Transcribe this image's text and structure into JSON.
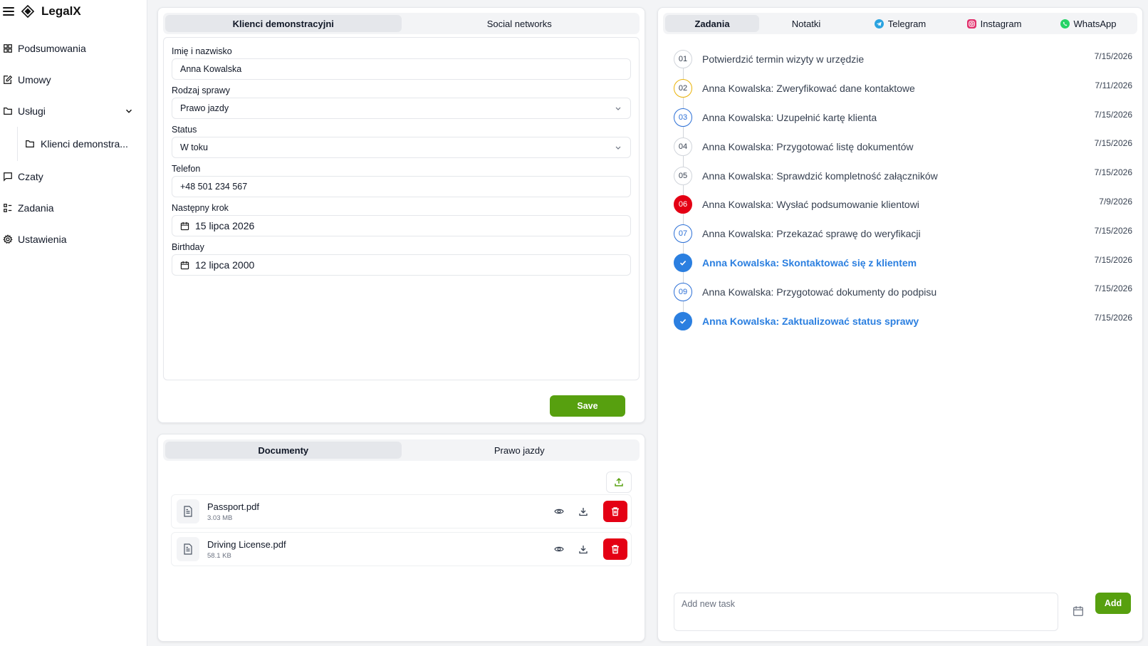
{
  "app": {
    "name": "LegalX"
  },
  "sidebar": {
    "items": [
      {
        "label": "Podsumowania",
        "icon": "dashboard-icon"
      },
      {
        "label": "Umowy",
        "icon": "edit-document-icon"
      },
      {
        "label": "Usługi",
        "icon": "folder-icon",
        "expanded": true
      },
      {
        "label": "Klienci demonstra...",
        "icon": "folder-icon",
        "sub": true
      },
      {
        "label": "Czaty",
        "icon": "chat-icon"
      },
      {
        "label": "Zadania",
        "icon": "list-icon"
      },
      {
        "label": "Ustawienia",
        "icon": "gear-icon"
      }
    ]
  },
  "client_card": {
    "tabs": [
      {
        "label": "Klienci demonstracyjni",
        "active": true
      },
      {
        "label": "Social networks",
        "active": false
      }
    ],
    "fields": {
      "name_label": "Imię i nazwisko",
      "name_value": "Anna Kowalska",
      "case_label": "Rodzaj sprawy",
      "case_value": "Prawo jazdy",
      "status_label": "Status",
      "status_value": "W toku",
      "phone_label": "Telefon",
      "phone_value": "+48 501 234 567",
      "next_label": "Następny krok",
      "next_value": "15 lipca 2026",
      "birthday_label": "Birthday",
      "birthday_value": "12 lipca 2000"
    },
    "save_label": "Save"
  },
  "docs_card": {
    "tabs": [
      {
        "label": "Documenty",
        "active": true
      },
      {
        "label": "Prawo jazdy",
        "active": false
      }
    ],
    "files": [
      {
        "name": "Passport.pdf",
        "size": "3.03 MB"
      },
      {
        "name": "Driving License.pdf",
        "size": "58.1 KB"
      }
    ]
  },
  "tasks_card": {
    "tabs": [
      {
        "label": "Zadania",
        "active": true,
        "icon": ""
      },
      {
        "label": "Notatki",
        "active": false,
        "icon": ""
      },
      {
        "label": "Telegram",
        "active": false,
        "icon": "telegram-icon",
        "color": "#2aa3e0"
      },
      {
        "label": "Instagram",
        "active": false,
        "icon": "instagram-icon",
        "color": "#e1306c"
      },
      {
        "label": "WhatsApp",
        "active": false,
        "icon": "whatsapp-icon",
        "color": "#25d366"
      }
    ],
    "tasks": [
      {
        "num": "01",
        "text": "Potwierdzić termin wizyty w urzędzie",
        "date": "7/15/2026",
        "state": "default"
      },
      {
        "num": "02",
        "text": "Anna Kowalska: Zweryfikować dane kontaktowe",
        "date": "7/11/2026",
        "state": "yellow"
      },
      {
        "num": "03",
        "text": "Anna Kowalska: Uzupełnić kartę klienta",
        "date": "7/15/2026",
        "state": "blue"
      },
      {
        "num": "04",
        "text": "Anna Kowalska: Przygotować listę dokumentów",
        "date": "7/15/2026",
        "state": "default"
      },
      {
        "num": "05",
        "text": "Anna Kowalska: Sprawdzić kompletność załączników",
        "date": "7/15/2026",
        "state": "default"
      },
      {
        "num": "06",
        "text": "Anna Kowalska: Wysłać podsumowanie klientowi",
        "date": "7/9/2026",
        "state": "red"
      },
      {
        "num": "07",
        "text": "Anna Kowalska: Przekazać sprawę do weryfikacji",
        "date": "7/15/2026",
        "state": "blue"
      },
      {
        "num": "",
        "text": "Anna Kowalska: Skontaktować się z klientem",
        "date": "7/15/2026",
        "state": "done"
      },
      {
        "num": "09",
        "text": "Anna Kowalska: Przygotować dokumenty do podpisu",
        "date": "7/15/2026",
        "state": "blue"
      },
      {
        "num": "",
        "text": "Anna Kowalska: Zaktualizować status sprawy",
        "date": "7/15/2026",
        "state": "done"
      }
    ],
    "new_task_placeholder": "Add new task",
    "add_label": "Add"
  },
  "colors": {
    "accent_green": "#57a00f",
    "danger_red": "#e40014",
    "link_blue": "#2b7fe0"
  }
}
